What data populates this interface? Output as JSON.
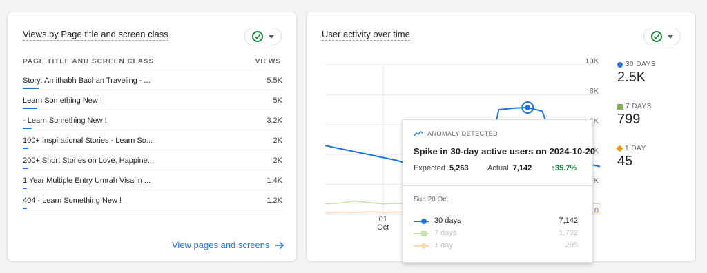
{
  "views_card": {
    "title": "Views by Page title and screen class",
    "col_page": "PAGE TITLE AND SCREEN CLASS",
    "col_views": "VIEWS",
    "rows": [
      {
        "label": "Story: Amithabh Bachan Traveling - ...",
        "value": "5.5K",
        "fraction": 0.06
      },
      {
        "label": "Learn Something New !",
        "value": "5K",
        "fraction": 0.055
      },
      {
        "label": "- Learn Something New !",
        "value": "3.2K",
        "fraction": 0.035
      },
      {
        "label": "100+ Inspirational Stories - Learn So...",
        "value": "2K",
        "fraction": 0.022
      },
      {
        "label": "200+ Short Stories on Love, Happine...",
        "value": "2K",
        "fraction": 0.022
      },
      {
        "label": "1 Year Multiple Entry Umrah Visa in ...",
        "value": "1.4K",
        "fraction": 0.016
      },
      {
        "label": "404 - Learn Something New !",
        "value": "1.2K",
        "fraction": 0.014
      }
    ],
    "link": "View pages and screens",
    "link_icon": "arrow-right-icon",
    "status_icon": "check-circle-icon"
  },
  "activity_card": {
    "title": "User activity over time",
    "status_icon": "check-circle-icon",
    "legend": [
      {
        "label": "30 DAYS",
        "value": "2.5K",
        "color": "#1a73e8",
        "marker": "dot"
      },
      {
        "label": "7 DAYS",
        "value": "799",
        "color": "#7cb342",
        "marker": "square"
      },
      {
        "label": "1 DAY",
        "value": "45",
        "color": "#f29900",
        "marker": "diamond"
      }
    ]
  },
  "chart_data": {
    "type": "line",
    "y_ticks": [
      "10K",
      "8K",
      "6K",
      "4K",
      "2K",
      "0"
    ],
    "ylim": [
      0,
      10000
    ],
    "x_tick": {
      "day": "01",
      "month": "Oct"
    },
    "series": [
      {
        "name": "30 days",
        "color": "#1a73e8",
        "values": [
          4600,
          4400,
          4200,
          4000,
          3800,
          3600,
          3300,
          3100,
          3000,
          2800,
          2700,
          2600,
          7000,
          7100,
          7142,
          6900,
          4400,
          3700,
          3400,
          3200
        ]
      },
      {
        "name": "7 days",
        "color": "#c5e1a5",
        "values": [
          700,
          750,
          900,
          800,
          700,
          750,
          700,
          650,
          700,
          600,
          600,
          500,
          2400,
          2500,
          1732,
          1200,
          900,
          800,
          800,
          700
        ]
      },
      {
        "name": "1 day",
        "color": "#ffd7a8",
        "values": [
          100,
          150,
          120,
          180,
          140,
          160,
          120,
          200,
          150,
          180,
          140,
          200,
          700,
          600,
          295,
          200,
          180,
          160,
          150,
          140
        ]
      }
    ],
    "highlight_index": 14
  },
  "tooltip": {
    "anomaly_label": "ANOMALY DETECTED",
    "title": "Spike in 30-day active users on 2024-10-20",
    "expected_label": "Expected",
    "expected_value": "5,263",
    "actual_label": "Actual",
    "actual_value": "7,142",
    "change": "↑35.7%",
    "change_color": "#188038",
    "date": "Sun 20 Oct",
    "rows": [
      {
        "name": "30 days",
        "value": "7,142",
        "color": "#1a73e8"
      },
      {
        "name": "7 days",
        "value": "1,732",
        "color": "#c5e1a5"
      },
      {
        "name": "1 day",
        "value": "295",
        "color": "#ffd7a8"
      }
    ]
  }
}
